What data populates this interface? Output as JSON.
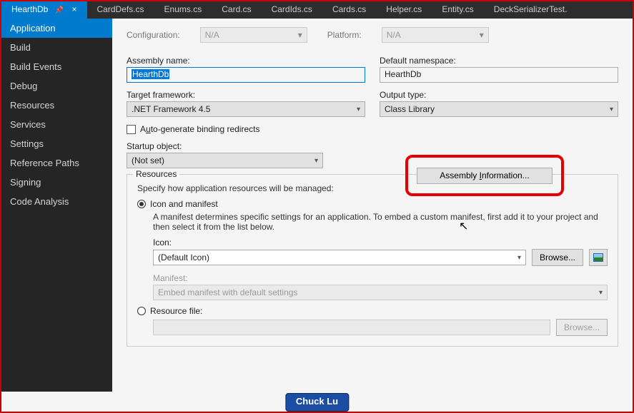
{
  "tabs": [
    {
      "label": "HearthDb",
      "active": true,
      "pinned": true
    },
    {
      "label": "CardDefs.cs"
    },
    {
      "label": "Enums.cs"
    },
    {
      "label": "Card.cs"
    },
    {
      "label": "CardIds.cs"
    },
    {
      "label": "Cards.cs"
    },
    {
      "label": "Helper.cs"
    },
    {
      "label": "Entity.cs"
    },
    {
      "label": "DeckSerializerTest."
    }
  ],
  "sidebar": {
    "items": [
      {
        "label": "Application",
        "active": true
      },
      {
        "label": "Build"
      },
      {
        "label": "Build Events"
      },
      {
        "label": "Debug"
      },
      {
        "label": "Resources"
      },
      {
        "label": "Services"
      },
      {
        "label": "Settings"
      },
      {
        "label": "Reference Paths"
      },
      {
        "label": "Signing"
      },
      {
        "label": "Code Analysis"
      }
    ]
  },
  "top": {
    "configuration_label": "Configuration:",
    "configuration_value": "N/A",
    "platform_label": "Platform:",
    "platform_value": "N/A"
  },
  "fields": {
    "assembly_name_label": "Assembly name:",
    "assembly_name_value": "HearthDb",
    "default_namespace_label": "Default namespace:",
    "default_namespace_value": "HearthDb",
    "target_framework_label": "Target framework:",
    "target_framework_value": ".NET Framework 4.5",
    "output_type_label": "Output type:",
    "output_type_value": "Class Library",
    "autogen_label": "Auto-generate binding redirects",
    "startup_label": "Startup object:",
    "startup_value": "(Not set)",
    "assembly_info_btn": "Assembly Information..."
  },
  "resources": {
    "legend": "Resources",
    "intro": "Specify how application resources will be managed:",
    "icon_manifest_label": "Icon and manifest",
    "icon_manifest_desc": "A manifest determines specific settings for an application. To embed a custom manifest, first add it to your project and then select it from the list below.",
    "icon_label": "Icon:",
    "icon_value": "(Default Icon)",
    "browse_label": "Browse...",
    "manifest_label": "Manifest:",
    "manifest_value": "Embed manifest with default settings",
    "resource_file_label": "Resource file:",
    "resource_file_value": ""
  },
  "author": "Chuck Lu"
}
